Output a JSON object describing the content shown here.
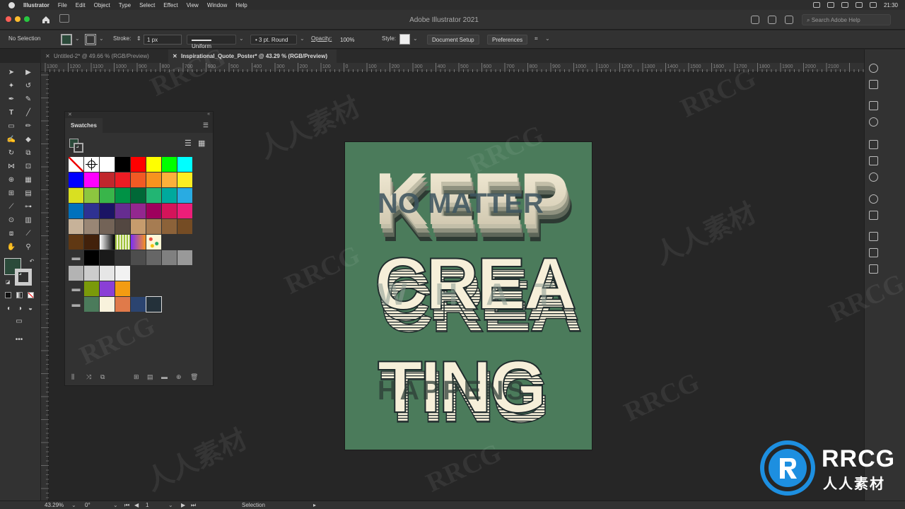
{
  "menubar": {
    "app": "Illustrator",
    "items": [
      "File",
      "Edit",
      "Object",
      "Type",
      "Select",
      "Effect",
      "View",
      "Window",
      "Help"
    ],
    "time": "21:30"
  },
  "window": {
    "title": "Adobe Illustrator 2021",
    "search_placeholder": "Search Adobe Help"
  },
  "control": {
    "selection": "No Selection",
    "stroke_label": "Stroke:",
    "stroke_value": "1 px",
    "profile": "Uniform",
    "brush": "3 pt. Round",
    "opacity_label": "Opacity:",
    "opacity_value": "100%",
    "style_label": "Style:",
    "doc_setup": "Document Setup",
    "preferences": "Preferences"
  },
  "tabs": [
    {
      "label": "Untitled-2* @ 49.66 % (RGB/Preview)",
      "active": false
    },
    {
      "label": "Inspirational_Quote_Poster* @ 43.29 % (RGB/Preview)",
      "active": true
    }
  ],
  "ruler": [
    "1300",
    "1200",
    "1100",
    "1000",
    "900",
    "800",
    "700",
    "600",
    "500",
    "400",
    "300",
    "200",
    "100",
    "0",
    "100",
    "200",
    "300",
    "400",
    "500",
    "600",
    "700",
    "800",
    "900",
    "1000",
    "1100",
    "1200",
    "1300",
    "1400",
    "1500",
    "1600",
    "1700",
    "1800",
    "1900",
    "2000",
    "2100"
  ],
  "swatches": {
    "title": "Swatches",
    "rows": [
      [
        "none",
        "reg",
        "#ffffff",
        "#000000",
        "#ff0000",
        "#ffff00",
        "#00ff00",
        "#00ffff"
      ],
      [
        "#0000ff",
        "#ff00ff",
        "#c1272d",
        "#ed1c24",
        "#f15a24",
        "#f7931e",
        "#fbb03b",
        "#fcee21"
      ],
      [
        "#d9e021",
        "#8cc63f",
        "#39b54a",
        "#009245",
        "#006837",
        "#22b573",
        "#00a99d",
        "#29abe2"
      ],
      [
        "#0071bc",
        "#2e3192",
        "#1b1464",
        "#662d91",
        "#93278f",
        "#9e005d",
        "#d4145a",
        "#ed1e79"
      ],
      [
        "#c7b299",
        "#998675",
        "#736357",
        "#534741",
        "#c69c6d",
        "#a67c52",
        "#8c6239",
        "#754c24"
      ],
      [
        "#603813",
        "#42210b",
        "grad-bw",
        "grad-green",
        "grad-purple",
        "pattern"
      ],
      [
        "folder",
        "#000000",
        "#1a1a1a",
        "#333333",
        "#4d4d4d",
        "#666666",
        "#808080",
        "#999999"
      ],
      [
        "#b3b3b3",
        "#cccccc",
        "#e6e6e6",
        "#f2f2f2"
      ],
      [
        "folder",
        "#7a9a0a",
        "#8a3fd6",
        "#f39c12"
      ],
      [
        "folder",
        "#4b7b5b",
        "#f8f2dc",
        "#e07a4a",
        "#2b4470",
        "#24313a"
      ]
    ]
  },
  "poster": {
    "bg": "#4b7b5b",
    "line1": "KEEP",
    "line2": "CREA",
    "line3": "TING",
    "over1": "NO MATTER",
    "over2": "WHAT",
    "over3": "HAPPENS",
    "cream": "#f6efd9",
    "dark": "#1f2b2c"
  },
  "status": {
    "zoom": "43.29%",
    "rotate": "0°",
    "artboard": "1",
    "tool": "Selection"
  },
  "watermark": {
    "text": "RRCG",
    "cn": "人人素材"
  }
}
